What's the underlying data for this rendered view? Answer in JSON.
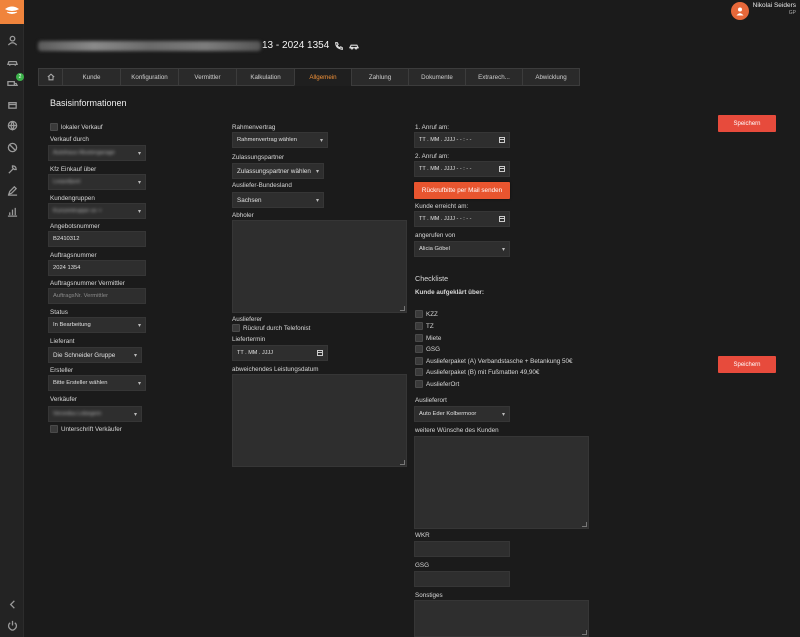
{
  "app": {
    "colors": {
      "accent": "#f39238",
      "button": "#e74b3c",
      "sidebar": "#232323",
      "background": "#1b1b1b"
    }
  },
  "user": {
    "name": "Nikolai Seiders",
    "role": "GP"
  },
  "header": {
    "title_suffix": "13 - 2024 1354"
  },
  "tabs": [
    {
      "label": ""
    },
    {
      "label": "Kunde"
    },
    {
      "label": "Konfiguration"
    },
    {
      "label": "Vermittler"
    },
    {
      "label": "Kalkulation"
    },
    {
      "label": "Allgemein"
    },
    {
      "label": "Zahlung"
    },
    {
      "label": "Dokumente"
    },
    {
      "label": "Extrarech..."
    },
    {
      "label": "Abwicklung"
    }
  ],
  "sidebar": {
    "badge": "2"
  },
  "section_title": "Basisinformationen",
  "col1": {
    "lokaler_verkauf": "lokaler Verkauf",
    "verkauf_durch_label": "Verkauf durch",
    "verkauf_durch_value": "Autohaus Mustergarage",
    "kfz_einkauf_label": "Kfz Einkauf über",
    "kfz_einkauf_value": "Leasefport",
    "kundengruppen_label": "Kundengruppen",
    "kundengruppen_value": "Kunzentruppe uv +",
    "angebotsnummer_label": "Angebotsnummer",
    "angebotsnummer_value": "B2410312",
    "auftragsnummer_label": "Auftragsnummer",
    "auftragsnummer_value": "2024 1354",
    "auftragsnummer_vermittler_label": "Auftragsnummer Vermittler",
    "auftragsnummer_vermittler_placeholder": "AuftragsNr. Vermittler",
    "status_label": "Status",
    "status_value": "In Bearbeitung",
    "lieferant_label": "Lieferant",
    "lieferant_value": "Die Schneider Gruppe",
    "ersteller_label": "Ersteller",
    "ersteller_value": "Bitte Ersteller wählen",
    "verkaeufer_label": "Verkäufer",
    "verkaeufer_value": "Veronika Lobegem",
    "unterschrift_label": "Unterschrift Verkäufer"
  },
  "col2": {
    "rahmenvertrag_label": "Rahmenvertrag",
    "rahmenvertrag_value": "Rahmenvertrag wählen",
    "zulassungspartner_label": "Zulassungspartner",
    "zulassungspartner_value": "Zulassungspartner wählen",
    "bundesland_label": "Ausliefer-Bundesland",
    "bundesland_value": "Sachsen",
    "abholer_label": "Abholer",
    "auslieferer_label": "Auslieferer",
    "rueckruf_label": "Rückruf durch Telefonist",
    "liefertermin_label": "Liefertermin",
    "liefertermin_value": "TT . MM . JJJJ",
    "leistungsdatum_label": "abweichendes Leistungsdatum"
  },
  "col3": {
    "anruf1_label": "1. Anruf am:",
    "anruf1_value": "TT . MM . JJJJ   - - : - -",
    "anruf2_label": "2. Anruf am:",
    "anruf2_value": "TT . MM . JJJJ   - - : - -",
    "rueckruf_button": "Rückrufbitte per Mail senden",
    "kunde_erreicht_label": "Kunde erreicht am:",
    "kunde_erreicht_value": "TT . MM . JJJJ   - - : - -",
    "angerufen_label": "angerufen von",
    "angerufen_value": "Alicia Göbel",
    "checkliste_title": "Checkliste",
    "checkliste_sub": "Kunde aufgeklärt über:",
    "check_items": [
      "KZZ",
      "TZ",
      "Miete",
      "GSG",
      "Auslieferpaket (A) Verbandstasche + Betankung 50€",
      "Auslieferpaket (B) mit Fußmatten 49,90€",
      "AuslieferOrt"
    ],
    "auslieferort_label": "Auslieferort",
    "auslieferort_value": "Auto Eder Kolbermoor",
    "wuensche_label": "weitere Wünsche des Kunden",
    "wkr_label": "WKR",
    "gsg_label": "GSG",
    "sonstiges_label": "Sonstiges"
  },
  "buttons": {
    "save_top": "Speichern",
    "save_mid": "Speichern"
  }
}
